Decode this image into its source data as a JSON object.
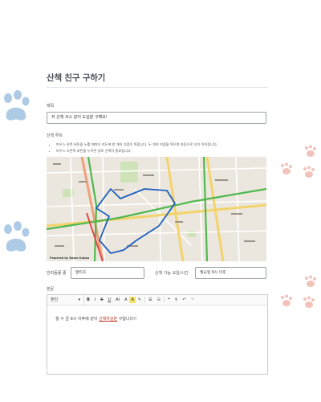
{
  "page": {
    "title": "산책 친구 구하기",
    "accent_color": "#4a4f5a",
    "paw_color_blue": "#aecbe6",
    "paw_color_pink": "#f2c3bd"
  },
  "form": {
    "subject_label": "제목",
    "subject_value": "저 산책 코스 같이 도실분 구해요!",
    "route_label": "산책 루트",
    "route_hints": [
      "마우스 왼쪽 버튼을 누를 때마다 지도에 한 개의 지점이 찍힙니다. 두 개의 지점을 찍으면 자동으로 선이 이어집니다.",
      "마우스 오른쪽 버튼을 누르면 경로 선택이 종료됩니다."
    ],
    "map_credit": "Powered by Daum Kakao",
    "breed_label": "반려동물 종",
    "breed_value": "말티즈",
    "time_label": "산책 가능 요일/시간",
    "time_value": "월요일 9시 이후",
    "body_label": "본문",
    "toolbar": {
      "font_label": "본인",
      "font_caret": "▾",
      "bold": "B",
      "italic": "I",
      "strike": "S",
      "underline": "U",
      "font_size": "AI",
      "text_color": "A",
      "bg_color": "A",
      "highlight": "✎",
      "bullet_list": "☰",
      "number_list": "☷",
      "quote": "❝",
      "link": "⚲",
      "undo": "↶",
      "redo": "↷"
    },
    "body_text_before": "월 수 금 9시 이후에 같이 ",
    "body_text_highlight": "산책하실분",
    "body_text_after": " 구합니다!!"
  }
}
